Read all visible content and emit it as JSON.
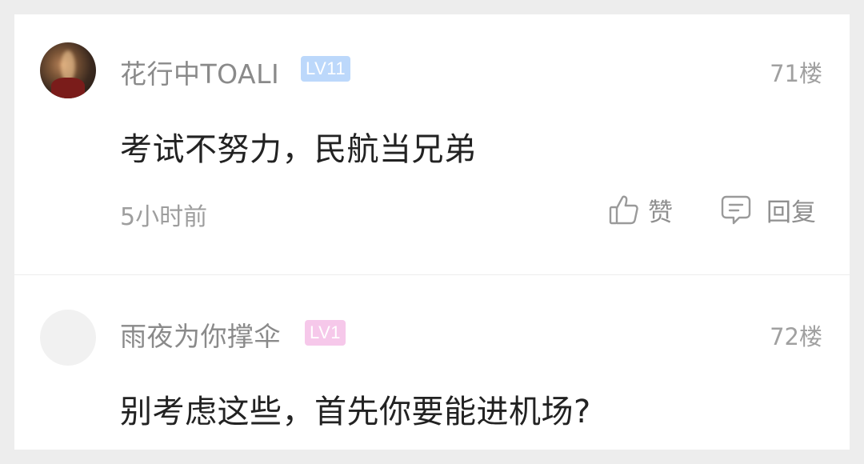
{
  "comments": [
    {
      "username": "花行中TOALI",
      "level": "LV11",
      "floor": "71楼",
      "content": "考试不努力，民航当兄弟",
      "time": "5小时前",
      "actions": {
        "like_label": "赞",
        "reply_label": "回复"
      }
    },
    {
      "username": "雨夜为你撑伞",
      "level": "LV1",
      "floor": "72楼",
      "content": "别考虑这些，首先你要能进机场?"
    }
  ],
  "icons": {
    "like": "thumbs-up-icon",
    "reply": "speech-bubble-icon"
  },
  "colors": {
    "level_blue": "#bcd8fb",
    "level_pink": "#f6c8ea",
    "username": "#8a8a8a",
    "content": "#222222",
    "background": "#ededed"
  }
}
